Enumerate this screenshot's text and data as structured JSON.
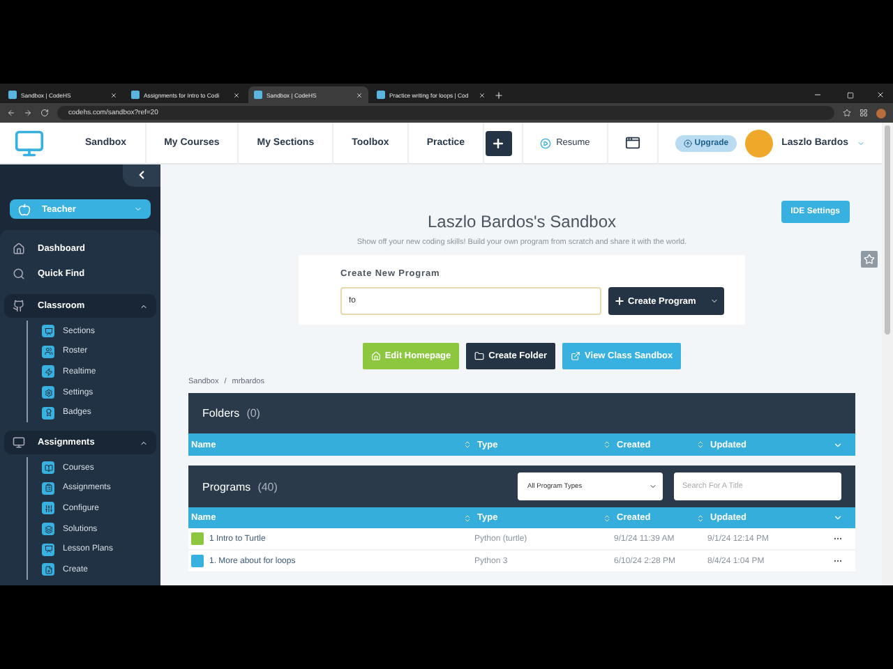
{
  "browser": {
    "tabs": [
      {
        "title": "Sandbox | CodeHS",
        "selected": false
      },
      {
        "title": "Assignments for Intro to Codi",
        "selected": false
      },
      {
        "title": "Sandbox | CodeHS",
        "selected": true
      },
      {
        "title": "Practice writing for loops | Cod",
        "selected": false
      }
    ],
    "url": "codehs.com/sandbox?ref=20"
  },
  "header": {
    "nav": [
      {
        "label": "Sandbox",
        "selected": false
      },
      {
        "label": "My Courses",
        "selected": false
      },
      {
        "label": "My Sections",
        "selected": false
      },
      {
        "label": "Toolbox",
        "selected": false
      },
      {
        "label": "Practice",
        "selected": false
      }
    ],
    "resume": "Resume",
    "upgrade": "Upgrade",
    "user": "Laszlo Bardos"
  },
  "sidebar": {
    "role": "Teacher",
    "top_items": [
      "Dashboard",
      "Quick Find"
    ],
    "sections": [
      {
        "title": "Classroom",
        "expanded": true,
        "items": [
          "Sections",
          "Roster",
          "Realtime",
          "Settings",
          "Badges"
        ]
      },
      {
        "title": "Assignments",
        "expanded": true,
        "items": [
          "Courses",
          "Assignments",
          "Configure",
          "Solutions",
          "Lesson Plans",
          "Create"
        ]
      }
    ]
  },
  "main": {
    "ide_settings": "IDE Settings",
    "title": "Laszlo Bardos's Sandbox",
    "subtitle": "Show off your new coding skills! Build your own program from scratch and share it with the world.",
    "create": {
      "label": "Create New Program",
      "value": "fo",
      "button": "Create Program"
    },
    "actions": [
      {
        "label": "Edit Homepage",
        "kind": "homepage"
      },
      {
        "label": "Create Folder",
        "kind": "folder"
      },
      {
        "label": "View Class Sandbox",
        "kind": "class"
      }
    ],
    "breadcrumb": [
      "Sandbox",
      "mrbardos"
    ],
    "breadcrumb_separator": "/",
    "folders": {
      "title": "Folders",
      "count": "(0)",
      "columns": [
        "Name",
        "Type",
        "Created",
        "Updated"
      ]
    },
    "programs": {
      "title": "Programs",
      "count": "(40)",
      "filter": "All Program Types",
      "search_placeholder": "Search For A Title",
      "columns": [
        "Name",
        "Type",
        "Created",
        "Updated"
      ],
      "rows": [
        {
          "name": "1 Intro to Turtle",
          "type": "Python (turtle)",
          "created": "9/1/24 11:39 AM",
          "updated": "9/1/24 12:14 PM",
          "kind": "turtle"
        },
        {
          "name": "1. More about for loops",
          "type": "Python 3",
          "created": "6/10/24 2:28 PM",
          "updated": "8/4/24 1:04 PM",
          "kind": "python"
        }
      ]
    }
  }
}
